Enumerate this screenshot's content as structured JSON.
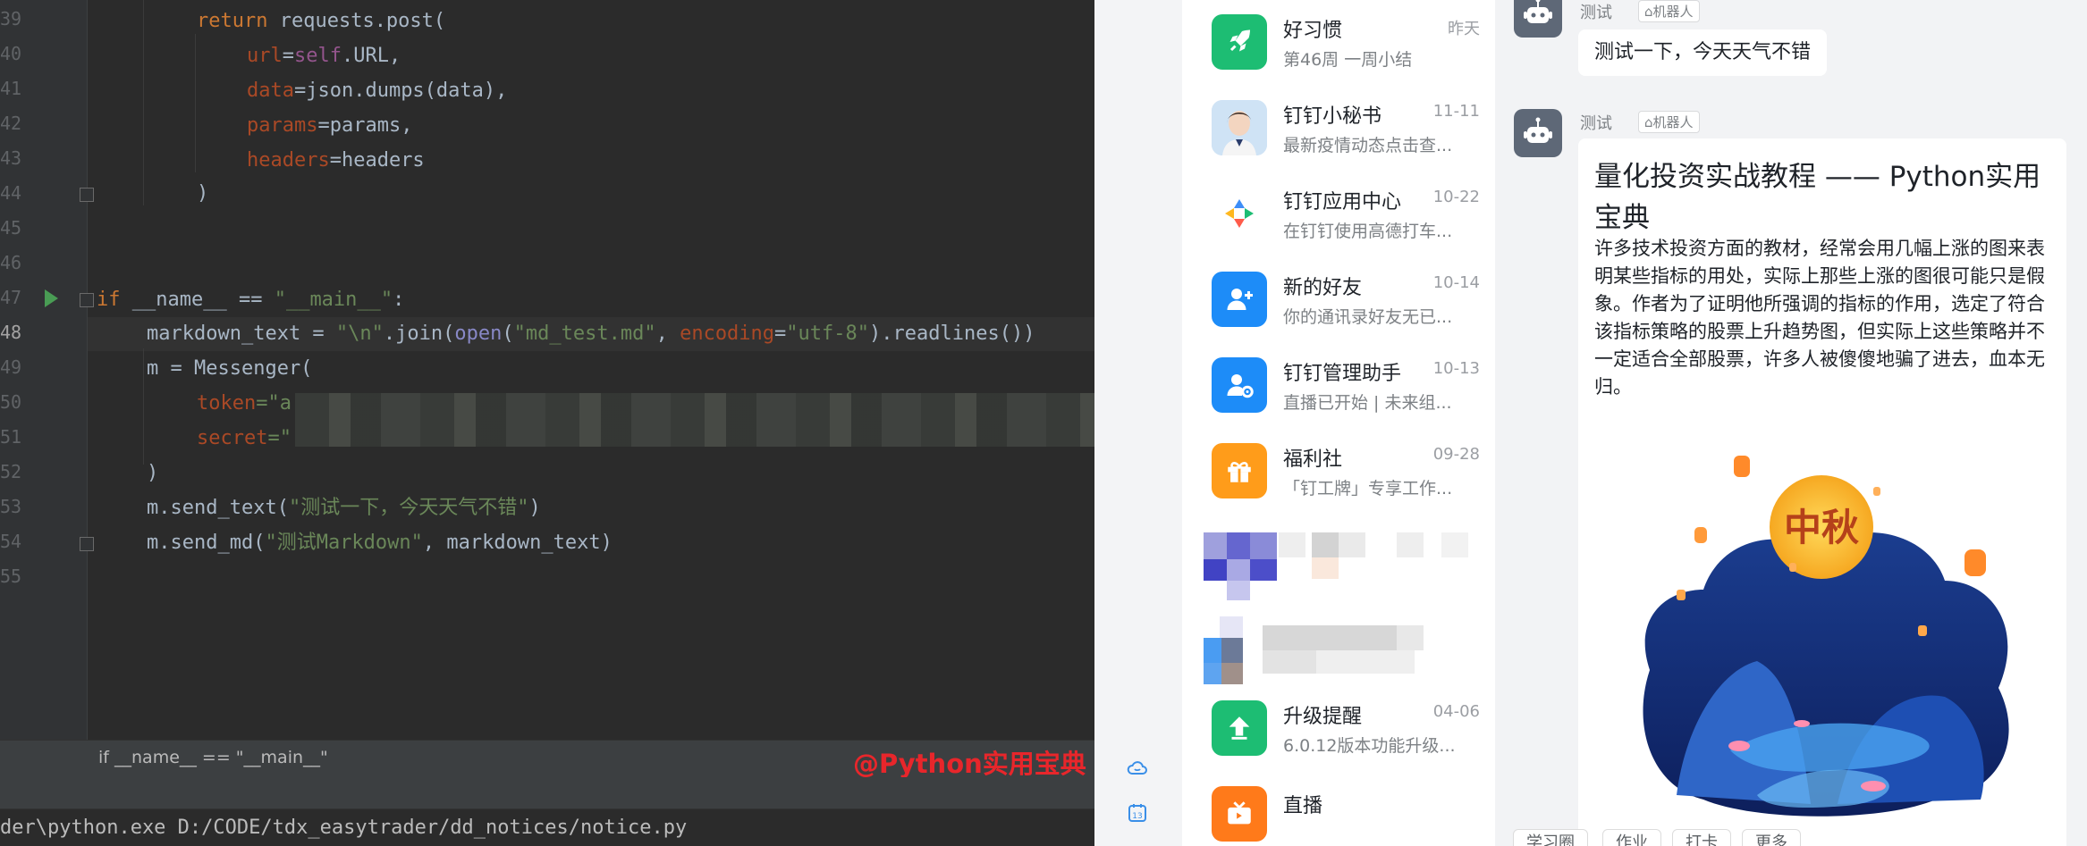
{
  "editor": {
    "line_numbers": [
      "39",
      "40",
      "41",
      "42",
      "43",
      "44",
      "45",
      "46",
      "47",
      "48",
      "49",
      "50",
      "51",
      "52",
      "53",
      "54",
      "55"
    ],
    "active_line": "48",
    "lines": {
      "l39_kw": "return",
      "l39_rest": " requests.post(",
      "l40_param": "url",
      "l40_eq": "=",
      "l40_self": "self",
      "l40_rest": ".URL,",
      "l41_param": "data",
      "l41_rest": "=json.dumps(data),",
      "l42_param": "params",
      "l42_rest": "=params,",
      "l43_param": "headers",
      "l43_rest": "=headers",
      "l44": ")",
      "l47_kw": "if",
      "l47_dunder": "__name__",
      "l47_op": " == ",
      "l47_str": "\"__main__\"",
      "l47_colon": ":",
      "l48_a": "markdown_text = ",
      "l48_str1": "\"\\n\"",
      "l48_b": ".join(",
      "l48_open": "open",
      "l48_c": "(",
      "l48_str2": "\"md_test.md\"",
      "l48_d": ", ",
      "l48_param": "encoding",
      "l48_e": "=",
      "l48_str3": "\"utf-8\"",
      "l48_f": ").readlines())",
      "l49": "m = Messenger(",
      "l50_param": "token",
      "l50_rest": "=\"a",
      "l51_param": "secret",
      "l51_rest": "=\"",
      "l52": ")",
      "l53_a": "m.send_text(",
      "l53_str": "\"测试一下，今天天气不错\"",
      "l53_b": ")",
      "l54_a": "m.send_md(",
      "l54_str": "\"测试Markdown\"",
      "l54_b": ", markdown_text)"
    },
    "breadcrumb": "if __name__ == \"__main__\"",
    "watermark": "@Python实用宝典",
    "console": "der\\python.exe D:/CODE/tdx_easytrader/dd_notices/notice.py"
  },
  "rail": {
    "icons": [
      "cloud-smile-icon",
      "calendar-icon"
    ],
    "calendar_day": "13"
  },
  "conversations": [
    {
      "name": "好习惯",
      "preview": "第46周 一周小结",
      "time": "昨天",
      "icon": "rocket-icon",
      "color": "#1dbd73"
    },
    {
      "name": "钉钉小秘书",
      "preview": "最新疫情动态点击查...",
      "time": "11-11",
      "icon": "assistant-avatar",
      "color": "#cfe3f5"
    },
    {
      "name": "钉钉应用中心",
      "preview": "在钉钉使用高德打车...",
      "time": "10-22",
      "icon": "app-center-icon",
      "color": "#ffffff"
    },
    {
      "name": "新的好友",
      "preview": "你的通讯录好友无已...",
      "time": "10-14",
      "icon": "add-friend-icon",
      "color": "#1d8cf8"
    },
    {
      "name": "钉钉管理助手",
      "preview": "直播已开始 | 未来组...",
      "time": "10-13",
      "icon": "admin-assistant-icon",
      "color": "#1d8cf8"
    },
    {
      "name": "福利社",
      "preview": "「钉工牌」专享工作...",
      "time": "09-28",
      "icon": "gift-icon",
      "color": "#ff9c1a"
    },
    {
      "name": "升级提醒",
      "preview": "6.0.12版本功能升级...",
      "time": "04-06",
      "icon": "upgrade-arrow-icon",
      "color": "#1dbd73"
    },
    {
      "name": "直播",
      "preview": "",
      "time": "",
      "icon": "live-tv-icon",
      "color": "#ff7a1a"
    }
  ],
  "chat": {
    "messages": [
      {
        "sender": "测试",
        "tag": "机器人",
        "text": "测试一下，今天天气不错"
      },
      {
        "sender": "测试",
        "tag": "机器人",
        "title": "量化投资实战教程 —— Python实用宝典",
        "body": "许多技术投资方面的教材，经常会用几幅上涨的图来表明某些指标的用处，实际上那些上涨的图很可能只是假象。作者为了证明他所强调的指标的作用，选定了符合该指标策略的股票上升趋势图，但实际上这些策略并不一定适合全部股票，许多人被傻傻地骗了进去，血本无归。",
        "image_text": "中秋"
      }
    ],
    "bottom_tabs": [
      "学习圈",
      "作业",
      "打卡",
      "更多"
    ]
  }
}
